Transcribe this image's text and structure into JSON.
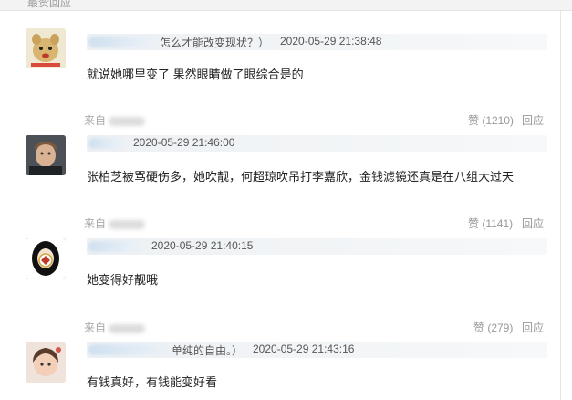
{
  "section": {
    "tab_label": "最赞回应"
  },
  "comments": [
    {
      "reply_quote": "怎么才能改变现状？）",
      "timestamp": "2020-05-29 21:38:48",
      "content": "就说她哪里变了 果然眼睛做了眼综合是的",
      "source": "来自",
      "like_label": "赞 (1210)",
      "reply_label": "回应"
    },
    {
      "reply_quote": "",
      "timestamp": "2020-05-29 21:46:00",
      "content": "张柏芝被骂硬伤多，她吹靓，何超琼吹吊打李嘉欣，金钱滤镜还真是在八组大过天",
      "source": "来自",
      "like_label": "赞 (1141)",
      "reply_label": "回应"
    },
    {
      "reply_quote": "",
      "timestamp": "2020-05-29 21:40:15",
      "content": "她变得好靓哦",
      "source": "来自",
      "like_label": "赞 (279)",
      "reply_label": "回应"
    },
    {
      "reply_quote": "单纯的自由。）",
      "timestamp": "2020-05-29 21:43:16",
      "content": "有钱真好，有钱能变好看",
      "source": "",
      "like_label": "",
      "reply_label": ""
    }
  ]
}
